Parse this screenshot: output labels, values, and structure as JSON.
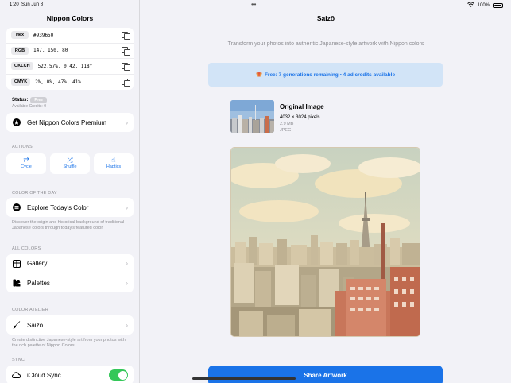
{
  "status_bar": {
    "time": "1:20",
    "date": "Sun Jun 8",
    "battery": "100%"
  },
  "sidebar": {
    "title": "Nippon Colors",
    "values": [
      {
        "label": "Hex",
        "value": "#939650"
      },
      {
        "label": "RGB",
        "value": "147, 150, 80"
      },
      {
        "label": "OKLCH",
        "value": "522.57%, 0.42, 118°"
      },
      {
        "label": "CMYK",
        "value": "2%, 0%, 47%, 41%"
      }
    ],
    "status_label": "Status:",
    "status_badge": "Free",
    "available_credits": "Available Credits: 0",
    "premium_label": "Get Nippon Colors Premium",
    "actions_header": "ACTIONS",
    "actions": [
      {
        "label": "Cycle",
        "icon": "cycle-icon"
      },
      {
        "label": "Shuffle",
        "icon": "shuffle-icon"
      },
      {
        "label": "Haptics",
        "icon": "haptics-icon"
      }
    ],
    "cotd_header": "COLOR OF THE DAY",
    "cotd_label": "Explore Today's Color",
    "cotd_desc": "Discover the origin and historical background of traditional Japanese colors through today's featured color.",
    "all_colors_header": "ALL COLORS",
    "gallery_label": "Gallery",
    "palettes_label": "Palettes",
    "atelier_header": "COLOR ATELIER",
    "saizo_label": "Saizō",
    "atelier_desc": "Create distinctive Japanese-style art from your photos with the rich palette of Nippon Colors.",
    "sync_header": "SYNC",
    "icloud_label": "iCloud Sync"
  },
  "main": {
    "title": "Saizō",
    "subtitle": "Transform your photos into authentic Japanese-style artwork with Nippon colors",
    "banner": "Free: 7 generations remaining • 4 ad credits available",
    "original": {
      "title": "Original Image",
      "dimensions": "4032 × 3024 pixels",
      "size": "2.9 MB",
      "format": "JPEG"
    },
    "share_label": "Share Artwork"
  },
  "colors": {
    "accent": "#1a73e8",
    "toggle_on": "#34c759",
    "swatch": "#939650"
  }
}
